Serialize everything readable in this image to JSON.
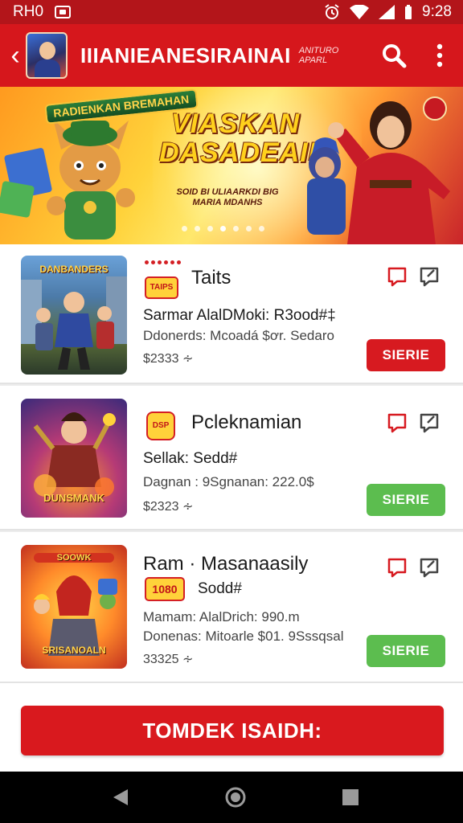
{
  "status_bar": {
    "carrier": "RH0",
    "time": "9:28"
  },
  "app_bar": {
    "title": "IIIANIEANESIRAINAI",
    "subtitle": "ANITURO APARL",
    "icons": [
      "back-arrow-icon",
      "search-icon",
      "more-vert-icon"
    ]
  },
  "banner": {
    "logo_text": "RADIENKAN BREMAHAN",
    "headline": "VIASKAN DASADEAIN",
    "tagline": "SOID BI ULIAARKDI BIG MARIA MDANHS",
    "page_dots": 7,
    "active_dot": 3
  },
  "cards": [
    {
      "tag": "TAIPS",
      "title": "Taits",
      "line1": "Sarmar AlalDMoki: R3ood#‡",
      "line2": "Ddonerds: Mcoadá $ơr. Sedaro",
      "price": "$2333 ∻",
      "thumb_label": "DANBANDERS",
      "button_label": "SIERIE",
      "button_color": "#d71a20"
    },
    {
      "tag": "DSP",
      "title": "Pcleknamian",
      "line1": "Sellak: Sedd#",
      "line2": "Dagnan : 9Sgnanan: 222.0$",
      "price": "$2323 ∻",
      "thumb_label": "DUNSMANK",
      "button_label": "SIERIE",
      "button_color": "#5cbd4f"
    },
    {
      "tag": "1080",
      "title": "Ram · Masanaasily",
      "line1": "Sodd#",
      "line2": "Mamam: AlalDrich: 990.m",
      "line3": "Donenas: Mitoarle $01. 9Sssqsal",
      "price": "33325 ∻",
      "thumb_label": "SRISANOALN",
      "button_label": "SIERIE",
      "button_color": "#5cbd4f"
    }
  ],
  "cta": {
    "label": "TOMDEK ISAIDH:"
  },
  "nav": {
    "icons": [
      "back-triangle-icon",
      "home-circle-icon",
      "recents-square-icon"
    ]
  }
}
